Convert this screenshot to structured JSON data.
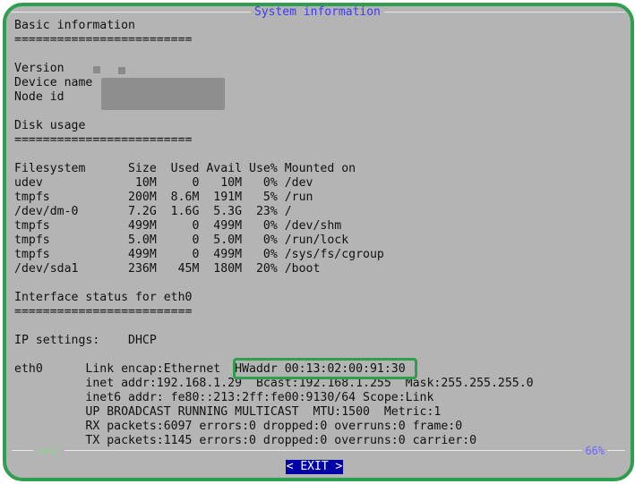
{
  "dialog": {
    "title": "System information",
    "scroll_indicator_left": "+(+)",
    "scroll_percent": "66%",
    "exit_button": "< EXIT >"
  },
  "content_lines": [
    "Basic information",
    "=========================",
    "",
    "Version",
    "Device name",
    "Node id",
    "",
    "Disk usage",
    "=========================",
    "",
    "Filesystem      Size  Used Avail Use% Mounted on",
    "udev             10M     0   10M   0% /dev",
    "tmpfs           200M  8.6M  191M   5% /run",
    "/dev/dm-0       7.2G  1.6G  5.3G  23% /",
    "tmpfs           499M     0  499M   0% /dev/shm",
    "tmpfs           5.0M     0  5.0M   0% /run/lock",
    "tmpfs           499M     0  499M   0% /sys/fs/cgroup",
    "/dev/sda1       236M   45M  180M  20% /boot",
    "",
    "Interface status for eth0",
    "=========================",
    "",
    "IP settings:    DHCP",
    "",
    "eth0      Link encap:Ethernet  HWaddr 00:13:02:00:91:30",
    "          inet addr:192.168.1.29  Bcast:192.168.1.255  Mask:255.255.255.0",
    "          inet6 addr: fe80::213:2ff:fe00:9130/64 Scope:Link",
    "          UP BROADCAST RUNNING MULTICAST  MTU:1500  Metric:1",
    "          RX packets:6097 errors:0 dropped:0 overruns:0 frame:0",
    "          TX packets:1145 errors:0 dropped:0 overruns:0 carrier:0"
  ],
  "colors": {
    "frame_border": "#2e9e4f",
    "dialog_bg": "#b4b4b4",
    "title_text": "#3a3aff",
    "button_bg": "#0000a8"
  }
}
